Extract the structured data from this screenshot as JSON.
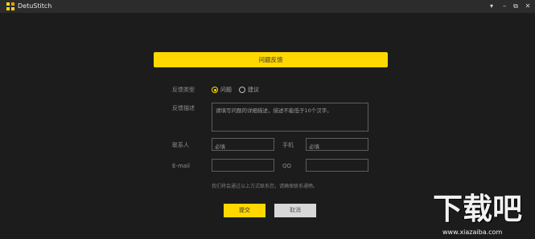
{
  "window": {
    "title": "DetuStitch",
    "controls": {
      "menu": "▾",
      "minimize": "–",
      "restore": "⧉",
      "close": "✕"
    },
    "logo_colors": [
      "#ffd800",
      "#ff9a00",
      "#ffd800",
      "#ffd800"
    ]
  },
  "form": {
    "header": "问题反馈",
    "type_label": "反馈类型",
    "type_options": [
      {
        "label": "问题",
        "selected": true
      },
      {
        "label": "建议",
        "selected": false
      }
    ],
    "desc_label": "反馈描述",
    "desc_placeholder": "请填写问题的详细描述，描述不能低于10个汉字。",
    "contact_label": "联系人",
    "contact_placeholder": "必填",
    "phone_label": "手机",
    "phone_placeholder": "必填",
    "email_label": "E-mail",
    "email_value": "",
    "qq_label": "QQ",
    "qq_value": "",
    "hint": "我们将会通过以上方式联系您，请确保联系通畅。",
    "submit": "提交",
    "cancel": "取消"
  },
  "watermark": {
    "logo_text": "下载吧",
    "url": "www.xiazaiba.com"
  },
  "colors": {
    "accent": "#ffd800",
    "background": "#1c1c1c",
    "titlebar": "#2c2c2c"
  }
}
